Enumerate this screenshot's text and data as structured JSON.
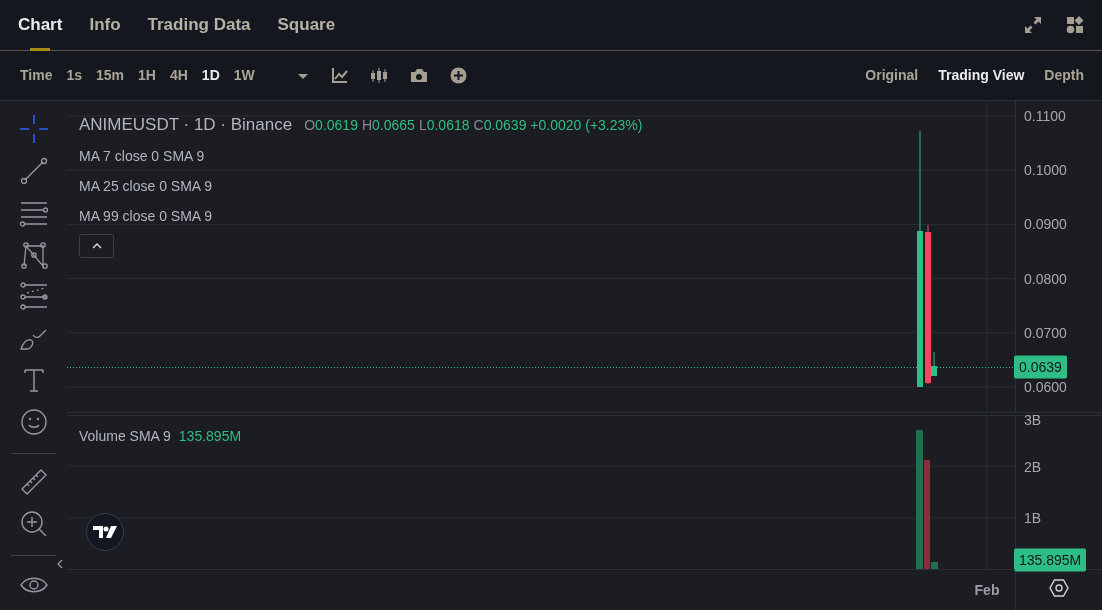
{
  "tabs": [
    {
      "label": "Chart",
      "selected": true
    },
    {
      "label": "Info",
      "selected": false
    },
    {
      "label": "Trading Data",
      "selected": false
    },
    {
      "label": "Square",
      "selected": false
    }
  ],
  "toolbar": {
    "intervals": [
      {
        "label": "Time",
        "selected": false
      },
      {
        "label": "1s",
        "selected": false
      },
      {
        "label": "15m",
        "selected": false
      },
      {
        "label": "1H",
        "selected": false
      },
      {
        "label": "4H",
        "selected": false
      },
      {
        "label": "1D",
        "selected": true
      },
      {
        "label": "1W",
        "selected": false
      }
    ],
    "views": [
      {
        "label": "Original",
        "selected": false
      },
      {
        "label": "Trading View",
        "selected": true
      },
      {
        "label": "Depth",
        "selected": false
      }
    ]
  },
  "sidebar": {
    "tools": [
      {
        "kind": "crosshair",
        "selected": true
      },
      {
        "kind": "trend-line",
        "selected": false
      },
      {
        "kind": "horizontal-lines",
        "selected": false
      },
      {
        "kind": "pattern",
        "selected": false
      },
      {
        "kind": "prediction",
        "selected": false
      },
      {
        "kind": "brush",
        "selected": false
      },
      {
        "kind": "text",
        "selected": false
      },
      {
        "kind": "emoji",
        "selected": false
      },
      {
        "kind": "divider"
      },
      {
        "kind": "ruler",
        "selected": false
      },
      {
        "kind": "zoom-in",
        "selected": false
      },
      {
        "kind": "divider"
      },
      {
        "kind": "eye",
        "selected": false
      }
    ]
  },
  "legend": {
    "title": "ANIMEUSDT · 1D · Binance",
    "ohlc": [
      {
        "key": "O",
        "value": "0.0619"
      },
      {
        "key": "H",
        "value": "0.0665"
      },
      {
        "key": "L",
        "value": "0.0618"
      },
      {
        "key": "C",
        "value": "0.0639"
      }
    ],
    "change": "+0.0020 (+3.23%)",
    "indicators": [
      "MA 7 close 0 SMA 9",
      "MA 25 close 0 SMA 9",
      "MA 99 close 0 SMA 9"
    ]
  },
  "price_axis": {
    "ticks": [
      "0.1100",
      "0.1000",
      "0.0900",
      "0.0800",
      "0.0700",
      "0.0600"
    ],
    "last_price": "0.0639"
  },
  "volume": {
    "label": "Volume SMA 9",
    "value": "135.895M",
    "ticks": [
      "3B",
      "2B",
      "1B"
    ],
    "last_value": "135.895M"
  },
  "time_axis": {
    "labels": [
      "Feb"
    ]
  }
}
